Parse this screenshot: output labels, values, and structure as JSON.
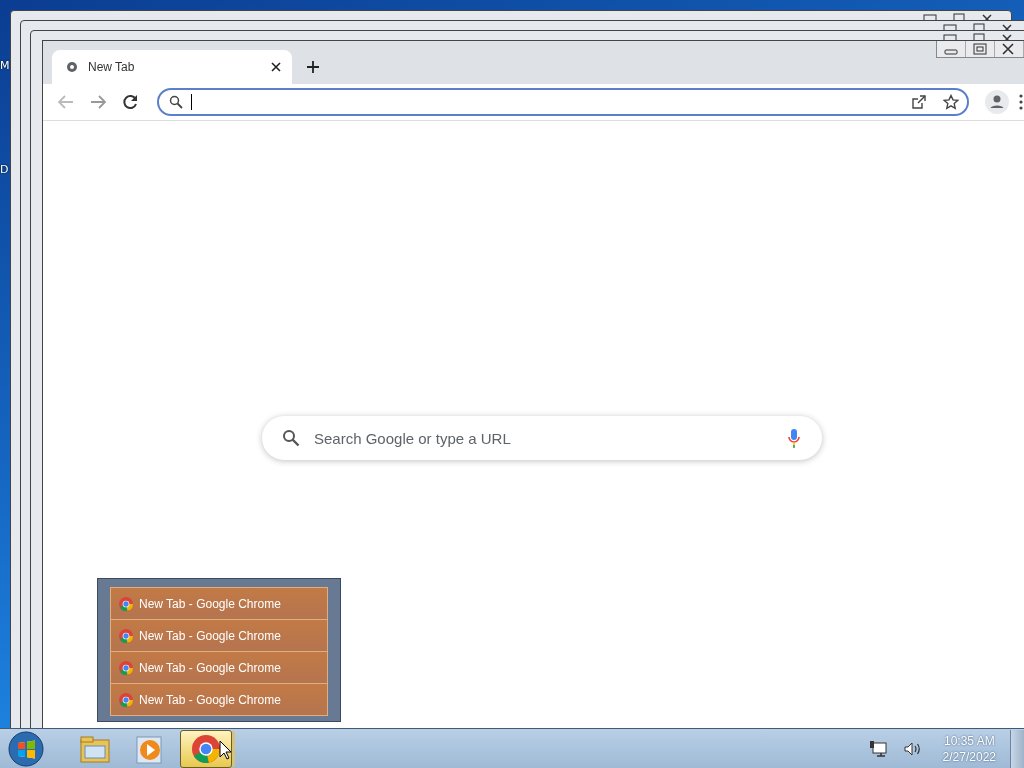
{
  "desktop_labels": [
    "M",
    "D"
  ],
  "browser": {
    "tabs": [
      {
        "title": "New Tab",
        "selected": true
      }
    ],
    "omnibox": {
      "focused": true
    },
    "search_box": {
      "placeholder": "Search Google or type a URL"
    }
  },
  "jump_list": {
    "items": [
      {
        "label": "New Tab - Google Chrome"
      },
      {
        "label": "New Tab - Google Chrome"
      },
      {
        "label": "New Tab - Google Chrome"
      },
      {
        "label": "New Tab - Google Chrome"
      }
    ]
  },
  "taskbar": {
    "buttons": [
      {
        "kind": "explorer",
        "active": false
      },
      {
        "kind": "media",
        "active": false
      },
      {
        "kind": "chrome",
        "active": true
      }
    ],
    "clock": {
      "time": "10:35 AM",
      "date": "2/27/2022"
    }
  }
}
